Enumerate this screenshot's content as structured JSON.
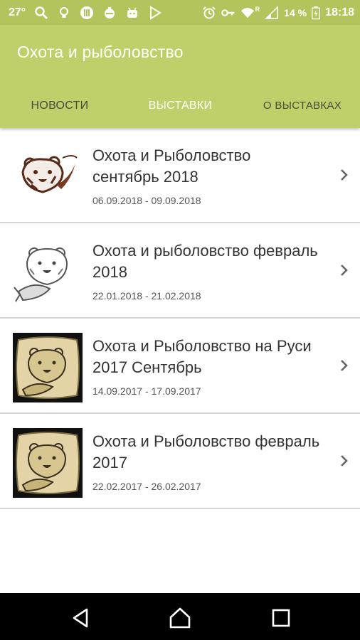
{
  "status_bar": {
    "temperature": "27°",
    "battery": "14 %",
    "time": "18:18",
    "signal_tag": "R"
  },
  "app": {
    "title": "Охота и рыболовство"
  },
  "tabs": [
    {
      "label": "НОВОСТИ",
      "selected": false
    },
    {
      "label": "ВЫСТАВКИ",
      "selected": true
    },
    {
      "label": "О ВЫСТАВКАХ",
      "selected": false
    }
  ],
  "exhibitions": [
    {
      "title": "Охота и Рыболовство сентябрь 2018",
      "dates": "06.09.2018 - 09.09.2018",
      "icon": "bear-fish-logo-brown"
    },
    {
      "title": "Охота и рыболовство февраль 2018",
      "dates": "22.01.2018 - 21.02.2018",
      "icon": "bear-fish-logo-gray"
    },
    {
      "title": "Охота и Рыболовство на Руси 2017 Сентябрь",
      "dates": "14.09.2017 - 17.09.2017",
      "icon": "bear-fish-logo-framed"
    },
    {
      "title": "Охота и Рыболовство февраль 2017",
      "dates": "22.02.2017 - 26.02.2017",
      "icon": "bear-fish-logo-framed"
    }
  ],
  "colors": {
    "status_bar": "#b3c45d",
    "app_bar": "#bfd06b",
    "selected_tab": "#ffffff",
    "unselected_tab": "#4a4a3a"
  }
}
